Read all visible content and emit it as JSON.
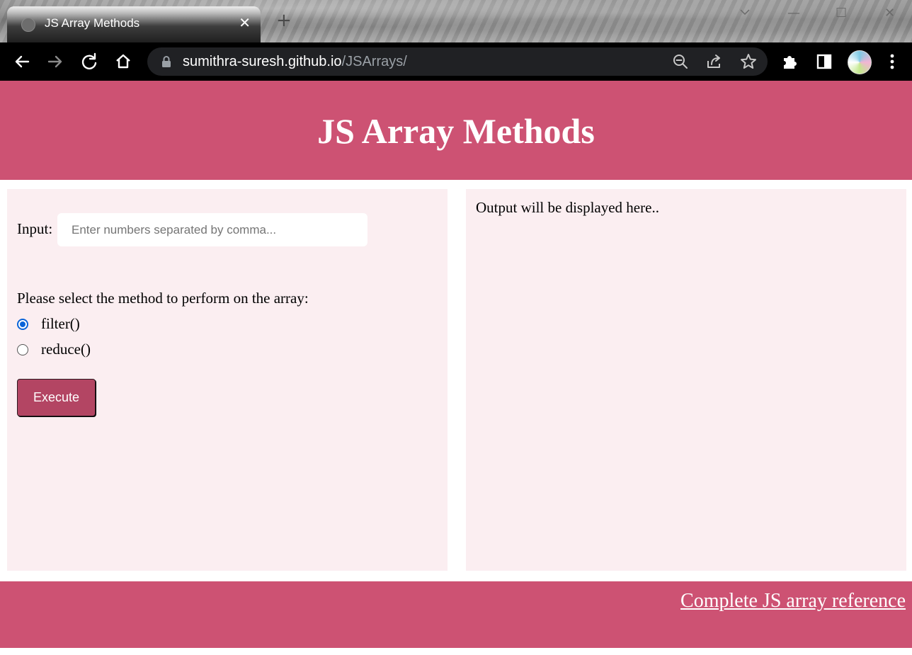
{
  "browser": {
    "tab": {
      "title": "JS Array Methods",
      "close_glyph": "✕"
    },
    "new_tab_glyph": "+",
    "window_controls": {
      "minimize_glyph": "—",
      "maximize_glyph": "☐",
      "close_glyph": "✕"
    },
    "address": {
      "domain": "sumithra-suresh.github.io",
      "path": "/JSArrays/"
    },
    "icons": [
      "back-arrow-icon",
      "forward-arrow-icon",
      "reload-icon",
      "home-icon",
      "lock-icon",
      "zoom-out-icon",
      "share-icon",
      "bookmark-star-icon",
      "extensions-puzzle-icon",
      "side-panel-icon",
      "profile-avatar",
      "more-menu-icon"
    ]
  },
  "page": {
    "title": "JS Array Methods",
    "input": {
      "label": "Input:",
      "placeholder": "Enter numbers separated by comma...",
      "value": ""
    },
    "method_prompt": "Please select the method to perform on the array:",
    "methods": [
      {
        "label": "filter()",
        "selected": true
      },
      {
        "label": "reduce()",
        "selected": false
      }
    ],
    "execute_label": "Execute",
    "output_text": "Output will be displayed here..",
    "footer_link": "Complete JS array reference"
  },
  "colors": {
    "brand_pink": "#cd5273",
    "panel_bg": "#fbeef1",
    "button_bg": "#b34563",
    "radio_accent": "#0a64d8"
  }
}
